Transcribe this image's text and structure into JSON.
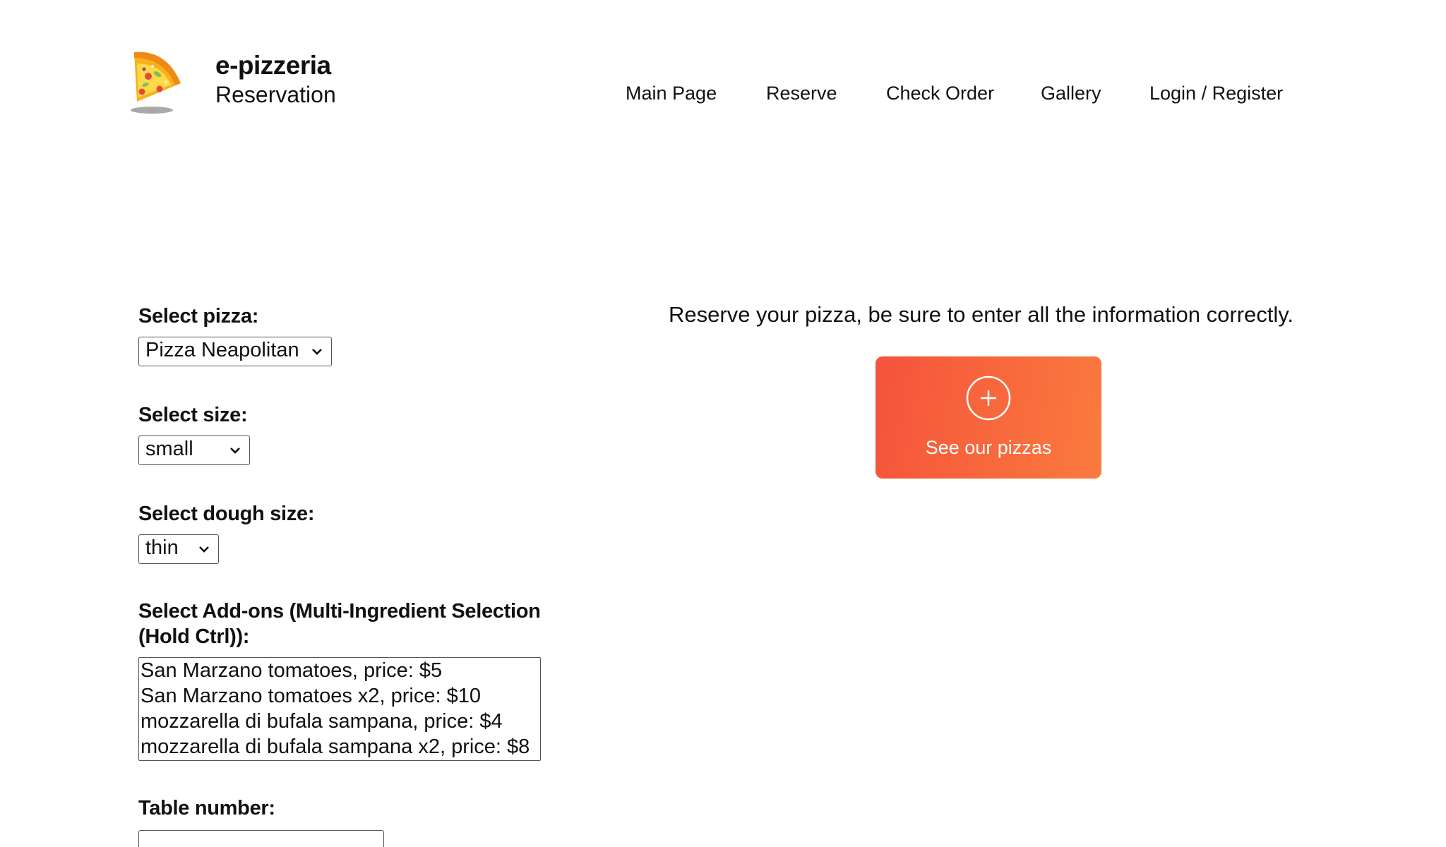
{
  "brand": {
    "logo_icon": "pizza-slice-icon",
    "title": "e-pizzeria",
    "subtitle": "Reservation"
  },
  "nav": {
    "items": [
      {
        "label": "Main Page"
      },
      {
        "label": "Reserve"
      },
      {
        "label": "Check Order"
      },
      {
        "label": "Gallery"
      },
      {
        "label": "Login / Register"
      }
    ]
  },
  "form": {
    "pizza_label": "Select pizza:",
    "pizza_value": "Pizza Neapolitan",
    "size_label": "Select size:",
    "size_value": "small",
    "dough_label": "Select dough size:",
    "dough_value": "thin",
    "addons_label_line1": "Select Add-ons (Multi-Ingredient Selection",
    "addons_label_line2": "(Hold Ctrl)):",
    "addons_options": [
      "San Marzano tomatoes, price: $5",
      "San Marzano tomatoes x2, price: $10",
      "mozzarella di bufala sampana, price: $4",
      "mozzarella di bufala sampana x2, price: $8"
    ],
    "table_label": "Table number:",
    "table_value": ""
  },
  "info": {
    "intro_text": "Reserve your pizza, be sure to enter all the information correctly.",
    "cta_label": "See our pizzas",
    "cta_icon": "plus-circle-icon"
  },
  "colors": {
    "cta_gradient_start": "#f4533b",
    "cta_gradient_end": "#fa7b3e",
    "text": "#111111"
  }
}
